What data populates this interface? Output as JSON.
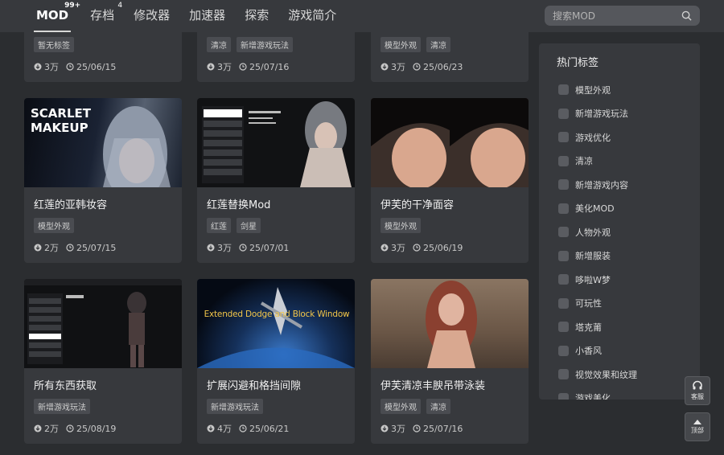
{
  "nav": {
    "items": [
      {
        "label": "MOD",
        "badge": "99+"
      },
      {
        "label": "存档",
        "badge": "4"
      },
      {
        "label": "修改器"
      },
      {
        "label": "加速器"
      },
      {
        "label": "探索"
      },
      {
        "label": "游戏简介"
      }
    ]
  },
  "search": {
    "placeholder": "搜索MOD"
  },
  "cards": [
    {
      "title": "",
      "tags": [
        "暂无标签"
      ],
      "downloads": "3万",
      "date": "25/06/15"
    },
    {
      "title": "",
      "tags": [
        "清凉",
        "新增游戏玩法"
      ],
      "downloads": "3万",
      "date": "25/07/16"
    },
    {
      "title": "",
      "tags": [
        "模型外观",
        "清凉"
      ],
      "downloads": "3万",
      "date": "25/06/23"
    },
    {
      "title": "红莲的亚韩妆容",
      "tags": [
        "模型外观"
      ],
      "downloads": "2万",
      "date": "25/07/15",
      "thumb_text": [
        "SCARLET",
        "MAKEUP"
      ]
    },
    {
      "title": "红莲替换Mod",
      "tags": [
        "红莲",
        "剑星"
      ],
      "downloads": "3万",
      "date": "25/07/01"
    },
    {
      "title": "伊芙的干净面容",
      "tags": [
        "模型外观"
      ],
      "downloads": "3万",
      "date": "25/06/19"
    },
    {
      "title": "所有东西获取",
      "tags": [
        "新增游戏玩法"
      ],
      "downloads": "2万",
      "date": "25/08/19"
    },
    {
      "title": "扩展闪避和格挡间隙",
      "tags": [
        "新增游戏玩法"
      ],
      "downloads": "4万",
      "date": "25/06/21",
      "thumb_text": [
        "Extended Dodge and Block Window"
      ]
    },
    {
      "title": "伊芙清凉丰腴吊带泳装",
      "tags": [
        "模型外观",
        "清凉"
      ],
      "downloads": "3万",
      "date": "25/07/16"
    }
  ],
  "sidebar": {
    "title": "热门标签",
    "tags": [
      "模型外观",
      "新增游戏玩法",
      "游戏优化",
      "清凉",
      "新增游戏内容",
      "美化MOD",
      "人物外观",
      "新增服装",
      "哆啦W梦",
      "可玩性",
      "塔克莆",
      "小香风",
      "视觉效果和纹理",
      "游戏美化"
    ]
  },
  "float": {
    "service": "客服",
    "top": "顶部"
  },
  "colors": {
    "bg": "#2b2d30",
    "panel": "#37393d",
    "tag": "#4a4c51"
  }
}
